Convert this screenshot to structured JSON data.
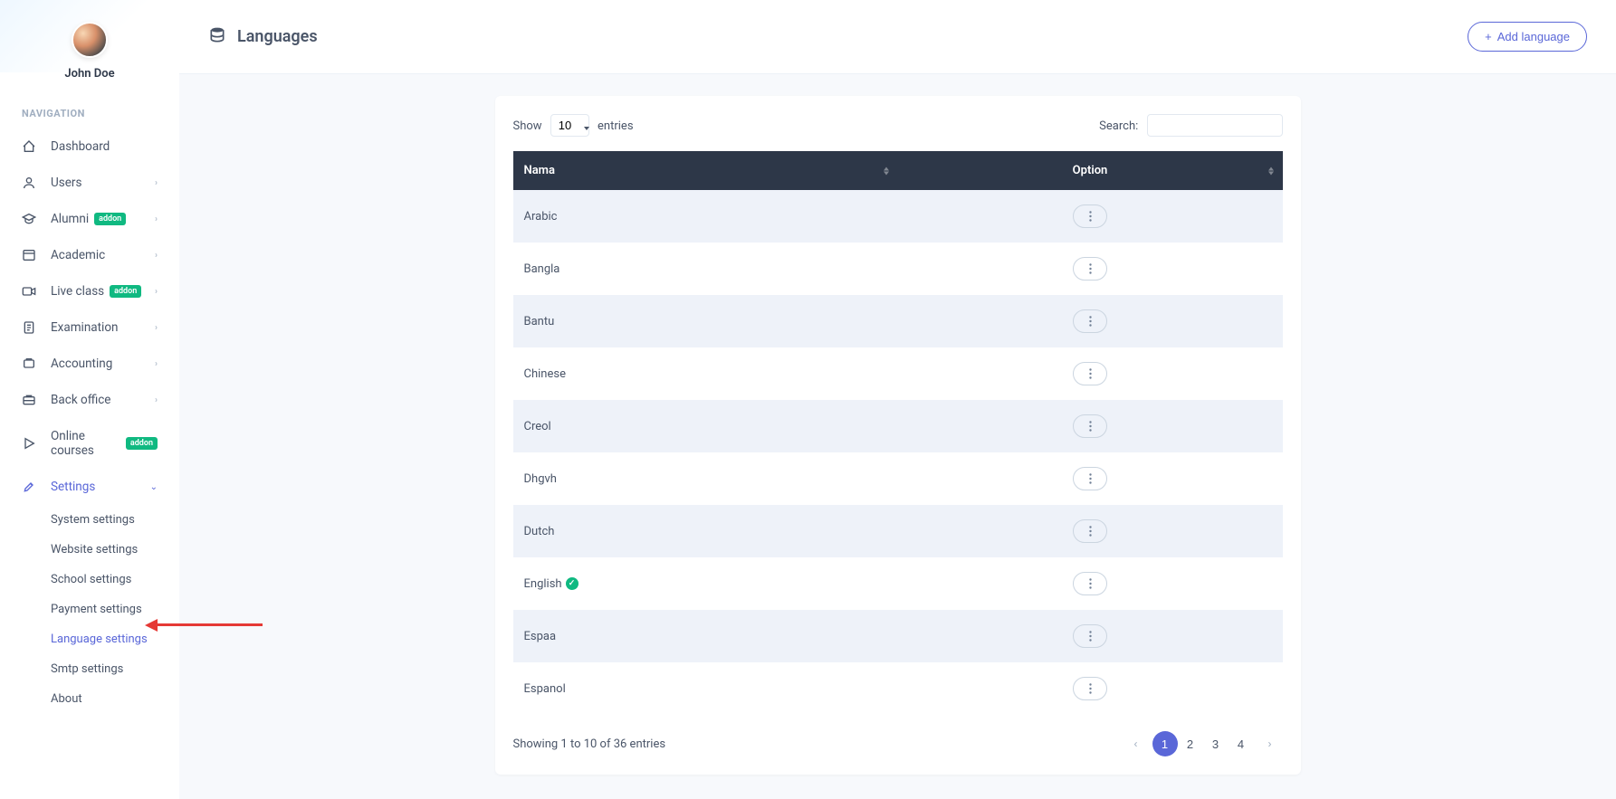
{
  "profile": {
    "name": "John Doe"
  },
  "nav": {
    "label": "NAVIGATION",
    "items": [
      {
        "label": "Dashboard",
        "icon": "dashboard",
        "chevron": false,
        "badge": null
      },
      {
        "label": "Users",
        "icon": "users",
        "chevron": true,
        "badge": null
      },
      {
        "label": "Alumni",
        "icon": "alumni",
        "chevron": true,
        "badge": "addon"
      },
      {
        "label": "Academic",
        "icon": "academic",
        "chevron": true,
        "badge": null
      },
      {
        "label": "Live class",
        "icon": "video",
        "chevron": true,
        "badge": "addon"
      },
      {
        "label": "Examination",
        "icon": "exam",
        "chevron": true,
        "badge": null
      },
      {
        "label": "Accounting",
        "icon": "accounting",
        "chevron": true,
        "badge": null
      },
      {
        "label": "Back office",
        "icon": "backoffice",
        "chevron": true,
        "badge": null
      },
      {
        "label": "Online courses",
        "icon": "play",
        "chevron": false,
        "badge": "addon"
      },
      {
        "label": "Settings",
        "icon": "settings",
        "chevron": true,
        "badge": null,
        "active": true,
        "expanded": true
      }
    ],
    "settings_sub": [
      {
        "label": "System settings"
      },
      {
        "label": "Website settings"
      },
      {
        "label": "School settings"
      },
      {
        "label": "Payment settings"
      },
      {
        "label": "Language settings",
        "active": true
      },
      {
        "label": "Smtp settings"
      },
      {
        "label": "About"
      }
    ]
  },
  "header": {
    "title": "Languages",
    "add_btn": "Add language"
  },
  "table": {
    "show_label": "Show",
    "entries_label": "entries",
    "entries_value": "10",
    "search_label": "Search:",
    "columns": {
      "nama": "Nama",
      "option": "Option"
    },
    "rows": [
      {
        "name": "Arabic",
        "check": false
      },
      {
        "name": "Bangla",
        "check": false
      },
      {
        "name": "Bantu",
        "check": false
      },
      {
        "name": "Chinese",
        "check": false
      },
      {
        "name": "Creol",
        "check": false
      },
      {
        "name": "Dhgvh",
        "check": false
      },
      {
        "name": "Dutch",
        "check": false
      },
      {
        "name": "English",
        "check": true
      },
      {
        "name": "Espaa",
        "check": false
      },
      {
        "name": "Espanol",
        "check": false
      }
    ],
    "info": "Showing 1 to 10 of 36 entries",
    "pages": [
      "1",
      "2",
      "3",
      "4"
    ],
    "active_page": "1"
  }
}
